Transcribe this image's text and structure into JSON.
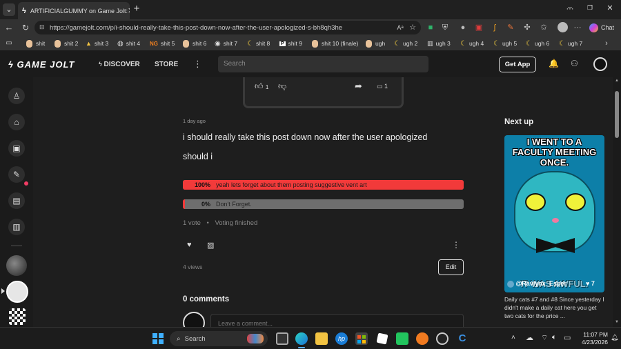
{
  "browser": {
    "tab_title": "ARTIFICIALGUMMY on Game Jolt:",
    "url": "https://gamejolt.com/p/i-should-really-take-this-post-down-now-after-the-user-apologized-s-bh8qh3he",
    "copilot_label": "Chat",
    "bookmarks": [
      "shit",
      "shit 2",
      "shit 3",
      "shit 4",
      "shit 5",
      "shit 6",
      "shit 7",
      "shit 8",
      "shit 9",
      "shit 10 (finale)",
      "ugh",
      "ugh 2",
      "ugh 3",
      "ugh 4",
      "ugh 5",
      "ugh 6",
      "ugh 7"
    ]
  },
  "nav": {
    "logo": "GAME JOLT",
    "discover": "DISCOVER",
    "store": "STORE",
    "search_placeholder": "Search",
    "get_app": "Get App"
  },
  "prev_post": {
    "like_count": "1",
    "comment_count": "1"
  },
  "post": {
    "timestamp": "1 day ago",
    "title": "i should really take this post down now after the user apologized",
    "body": "should i",
    "poll": [
      {
        "percent": "100%",
        "label": "yeah lets forget about them posting suggestive vent art",
        "fraction": 1.0
      },
      {
        "percent": "0%",
        "label": "Don't Forget.",
        "fraction": 0.0
      }
    ],
    "vote_count": "1 vote",
    "vote_status": "Voting finished",
    "views": "4 views",
    "edit_label": "Edit",
    "comments_heading": "0 comments",
    "comment_placeholder": "Leave a comment..."
  },
  "next_up": {
    "heading": "Next up",
    "image_caption_top": "I WENT TO A FACULTY MEETING ONCE.",
    "image_caption_bottom": "IT WAS AWFUL.",
    "author": "@Ravlynx_Esper",
    "likes": "7",
    "description": "Daily cats #7 and #8 Since yesterday I didn't make a daily cat here you get two cats for the price ..."
  },
  "taskbar": {
    "search_label": "Search",
    "time": "11:07 PM",
    "date": "4/23/2026"
  },
  "colors": {
    "poll_fill": "#f23a3a",
    "poll_empty": "#6e6e6e",
    "bg": "#1e1e1e"
  }
}
